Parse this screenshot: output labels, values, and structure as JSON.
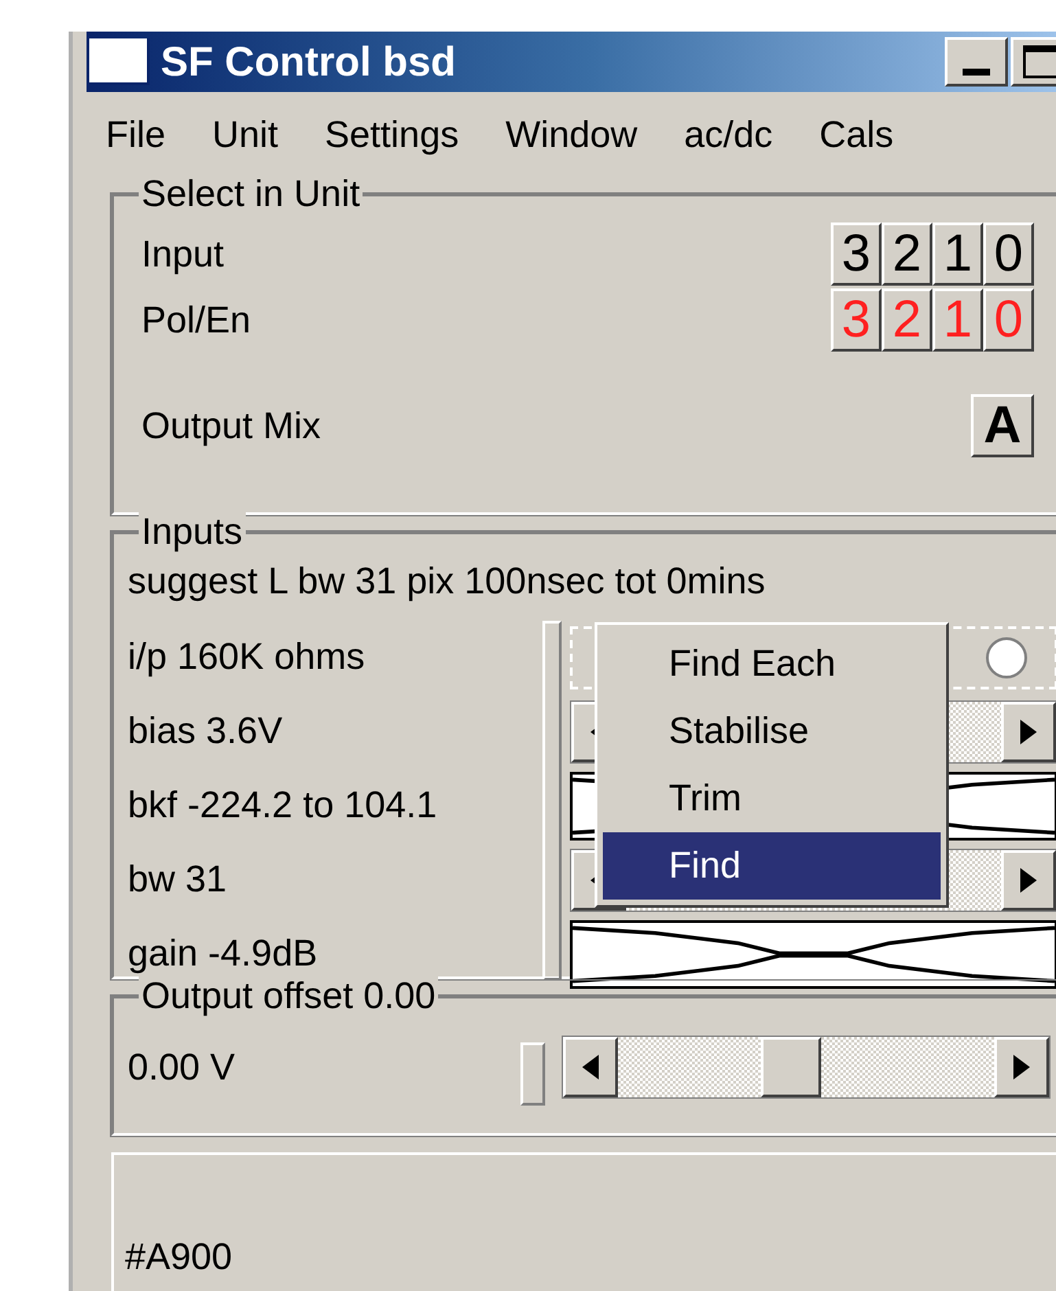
{
  "window": {
    "title": "SF Control bsd"
  },
  "menu": [
    "File",
    "Unit",
    "Settings",
    "Window",
    "ac/dc",
    "Cals"
  ],
  "select_in_unit": {
    "title": "Select in Unit",
    "rows": [
      {
        "label": "Input",
        "color": "#000000",
        "buttons": [
          "3",
          "2",
          "1",
          "0"
        ]
      },
      {
        "label": "Pol/En",
        "color": "#ff2020",
        "buttons": [
          "3",
          "2",
          "1",
          "0"
        ]
      }
    ],
    "output_mix": {
      "label": "Output Mix",
      "button": "A"
    }
  },
  "inputs": {
    "title": "Inputs",
    "summary": "suggest L bw 31 pix 100nsec tot 0mins",
    "rows": [
      {
        "label": "i/p 160K ohms",
        "kind": "radio",
        "checked": false
      },
      {
        "label": "bias 3.6V",
        "kind": "scrollbar"
      },
      {
        "label": "bkf -224.2 to 104.1",
        "kind": "waveform"
      },
      {
        "label": "bw 31",
        "kind": "scrollbar"
      },
      {
        "label": "gain -4.9dB",
        "kind": "waveform"
      }
    ]
  },
  "context_menu": [
    {
      "label": "Find Each",
      "selected": false
    },
    {
      "label": "Stabilise",
      "selected": false
    },
    {
      "label": "Trim",
      "selected": false
    },
    {
      "label": "Find",
      "selected": true
    }
  ],
  "output_offset": {
    "title": "Output offset 0.00",
    "value": "0.00 V",
    "level": 0.45
  },
  "status": {
    "text": "#A900"
  }
}
